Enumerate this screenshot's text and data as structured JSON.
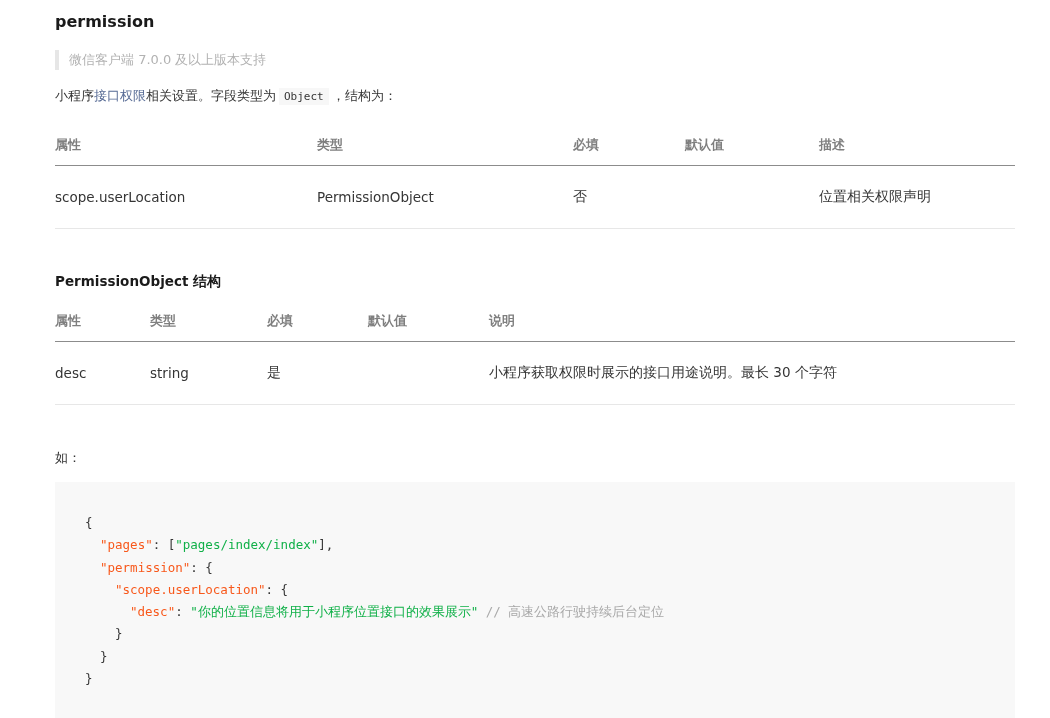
{
  "title": "permission",
  "note": "微信客户端 7.0.0 及以上版本支持",
  "intro": {
    "before": "小程序",
    "link": "接口权限",
    "after": "相关设置。字段类型为",
    "code": "Object",
    "end": "，结构为："
  },
  "table": {
    "columns": [
      "属性",
      "类型",
      "必填",
      "默认值",
      "描述"
    ],
    "rows": [
      [
        "scope.userLocation",
        "PermissionObject",
        "否",
        "",
        "位置相关权限声明"
      ]
    ]
  },
  "subtitle": "PermissionObject 结构",
  "table2": {
    "columns": [
      "属性",
      "类型",
      "必填",
      "默认值",
      "说明"
    ],
    "rows": [
      [
        "desc",
        "string",
        "是",
        "",
        "小程序获取权限时展示的接口用途说明。最长 30 个字符"
      ]
    ]
  },
  "example_label": "如：",
  "code": [
    {
      "tokens": [
        {
          "kind": "punct",
          "text": "{"
        }
      ],
      "children": [
        {
          "tokens": [
            {
              "kind": "key",
              "text": "\"pages\""
            },
            {
              "kind": "punct",
              "text": ": ["
            },
            {
              "kind": "string",
              "text": "\"pages/index/index\""
            },
            {
              "kind": "punct",
              "text": "],"
            }
          ]
        },
        {
          "tokens": [
            {
              "kind": "key",
              "text": "\"permission\""
            },
            {
              "kind": "punct",
              "text": ": {"
            }
          ],
          "children": [
            {
              "tokens": [
                {
                  "kind": "key",
                  "text": "\"scope.userLocation\""
                },
                {
                  "kind": "punct",
                  "text": ": {"
                }
              ],
              "children": [
                {
                  "tokens": [
                    {
                      "kind": "key",
                      "text": "\"desc\""
                    },
                    {
                      "kind": "punct",
                      "text": ": "
                    },
                    {
                      "kind": "string",
                      "text": "\"你的位置信息将用于小程序位置接口的效果展示\""
                    },
                    {
                      "kind": "comment",
                      "text": " // 高速公路行驶持续后台定位"
                    }
                  ]
                }
              ]
            },
            {
              "tokens": [
                {
                  "kind": "punct",
                  "text": "}"
                }
              ]
            }
          ]
        },
        {
          "tokens": [
            {
              "kind": "punct",
              "text": "}"
            }
          ]
        }
      ]
    },
    {
      "tokens": [
        {
          "kind": "punct",
          "text": "}"
        }
      ]
    }
  ]
}
